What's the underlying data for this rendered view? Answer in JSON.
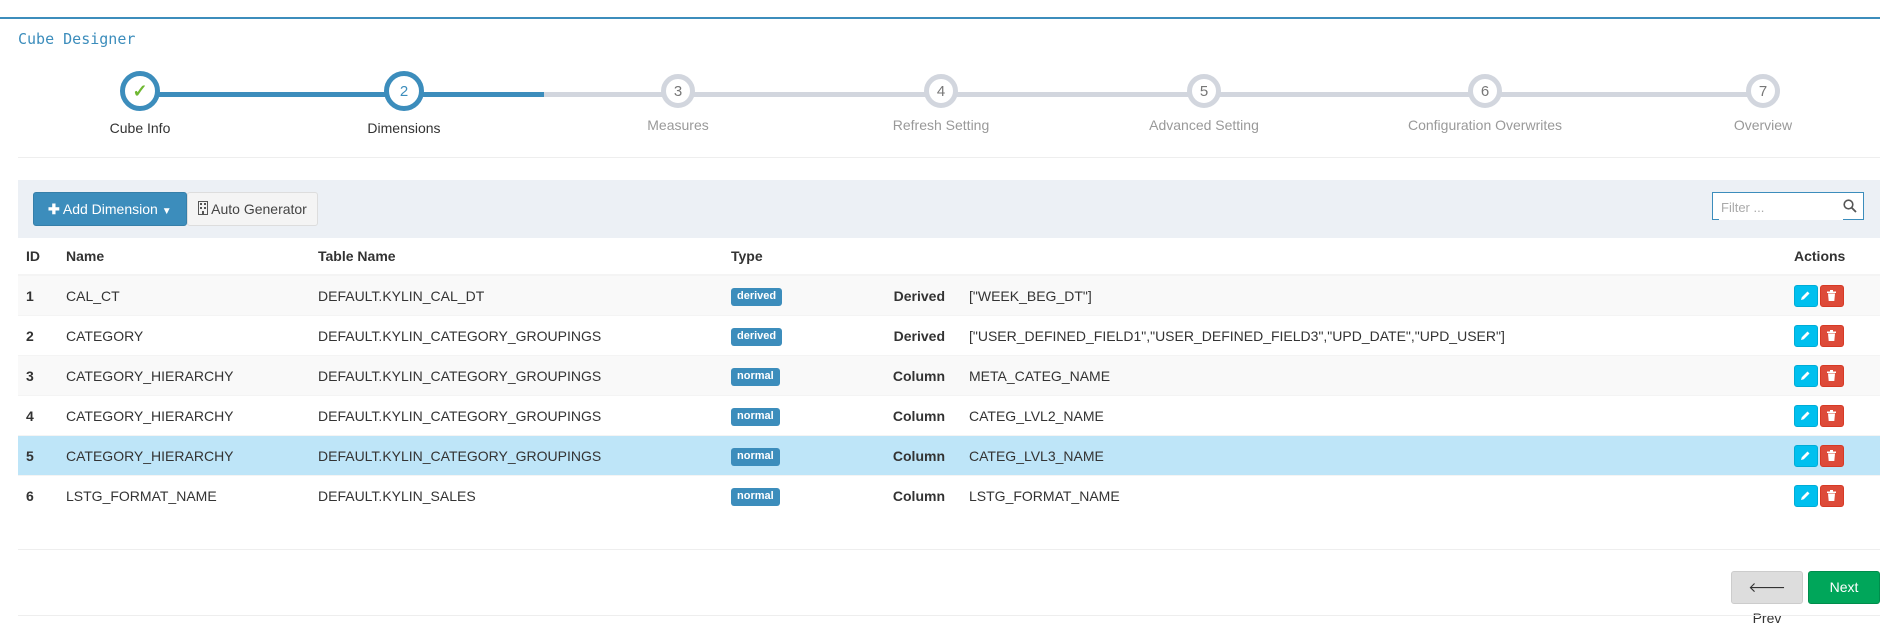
{
  "title": "Cube Designer",
  "steps": [
    {
      "number": "1",
      "label": "Cube Info",
      "state": "done"
    },
    {
      "number": "2",
      "label": "Dimensions",
      "state": "active"
    },
    {
      "number": "3",
      "label": "Measures",
      "state": "todo"
    },
    {
      "number": "4",
      "label": "Refresh Setting",
      "state": "todo"
    },
    {
      "number": "5",
      "label": "Advanced Setting",
      "state": "todo"
    },
    {
      "number": "6",
      "label": "Configuration Overwrites",
      "state": "todo"
    },
    {
      "number": "7",
      "label": "Overview",
      "state": "todo"
    }
  ],
  "toolbar": {
    "add_label": "Add Dimension",
    "auto_label": "Auto Generator",
    "filter_placeholder": "Filter ..."
  },
  "table": {
    "headers": {
      "id": "ID",
      "name": "Name",
      "table_name": "Table Name",
      "type": "Type",
      "actions": "Actions"
    },
    "rows": [
      {
        "id": "1",
        "name": "CAL_CT",
        "table": "DEFAULT.KYLIN_CAL_DT",
        "type": "derived",
        "kind": "Derived",
        "value": "[\"WEEK_BEG_DT\"]"
      },
      {
        "id": "2",
        "name": "CATEGORY",
        "table": "DEFAULT.KYLIN_CATEGORY_GROUPINGS",
        "type": "derived",
        "kind": "Derived",
        "value": "[\"USER_DEFINED_FIELD1\",\"USER_DEFINED_FIELD3\",\"UPD_DATE\",\"UPD_USER\"]"
      },
      {
        "id": "3",
        "name": "CATEGORY_HIERARCHY",
        "table": "DEFAULT.KYLIN_CATEGORY_GROUPINGS",
        "type": "normal",
        "kind": "Column",
        "value": "META_CATEG_NAME"
      },
      {
        "id": "4",
        "name": "CATEGORY_HIERARCHY",
        "table": "DEFAULT.KYLIN_CATEGORY_GROUPINGS",
        "type": "normal",
        "kind": "Column",
        "value": "CATEG_LVL2_NAME"
      },
      {
        "id": "5",
        "name": "CATEGORY_HIERARCHY",
        "table": "DEFAULT.KYLIN_CATEGORY_GROUPINGS",
        "type": "normal",
        "kind": "Column",
        "value": "CATEG_LVL3_NAME"
      },
      {
        "id": "6",
        "name": "LSTG_FORMAT_NAME",
        "table": "DEFAULT.KYLIN_SALES",
        "type": "normal",
        "kind": "Column",
        "value": "LSTG_FORMAT_NAME"
      }
    ]
  },
  "nav": {
    "prev_label": "Prev",
    "next_label": "Next"
  },
  "colors": {
    "primary": "#3c8dbc",
    "success": "#00a65a",
    "danger": "#dd4b39",
    "info": "#00c0ef",
    "highlight_row": "#bee5f8"
  }
}
